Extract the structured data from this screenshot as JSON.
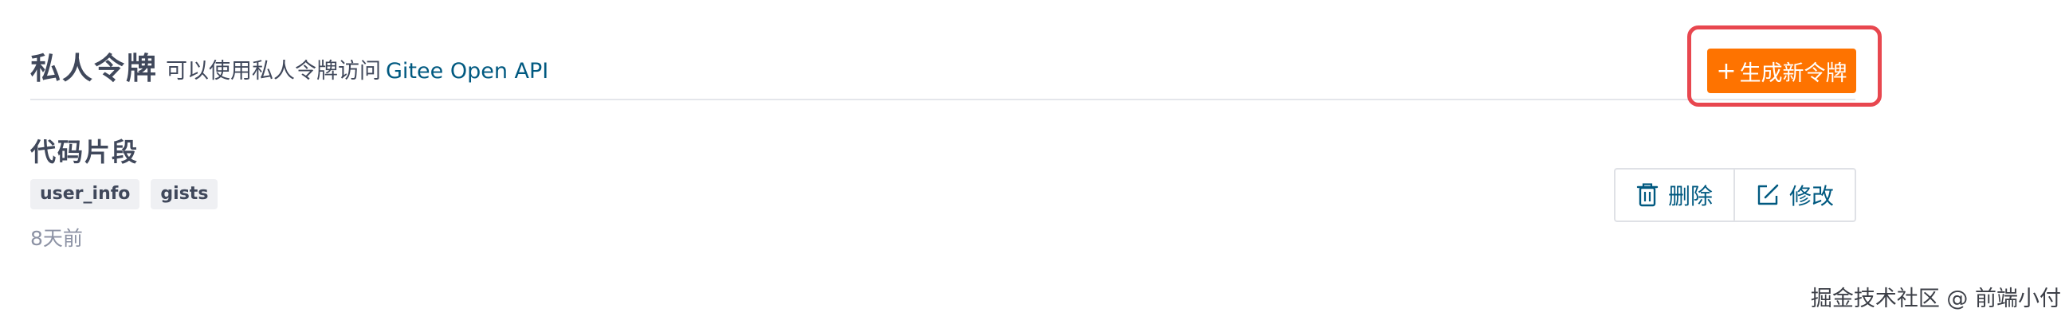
{
  "header": {
    "title": "私人令牌",
    "subtitle": "可以使用私人令牌访问",
    "subtitle_link": "Gitee Open API",
    "generate_button": {
      "icon": "plus-icon",
      "label": "生成新令牌",
      "color": "#fe7300"
    }
  },
  "token": {
    "name": "代码片段",
    "scopes": [
      "user_info",
      "gists"
    ],
    "created": "8天前",
    "actions": {
      "delete": {
        "icon": "trash-icon",
        "label": "删除"
      },
      "edit": {
        "icon": "edit-icon",
        "label": "修改"
      }
    }
  },
  "highlight": {
    "color": "#e8474f"
  },
  "watermark": "掘金技术社区 @ 前端小付"
}
